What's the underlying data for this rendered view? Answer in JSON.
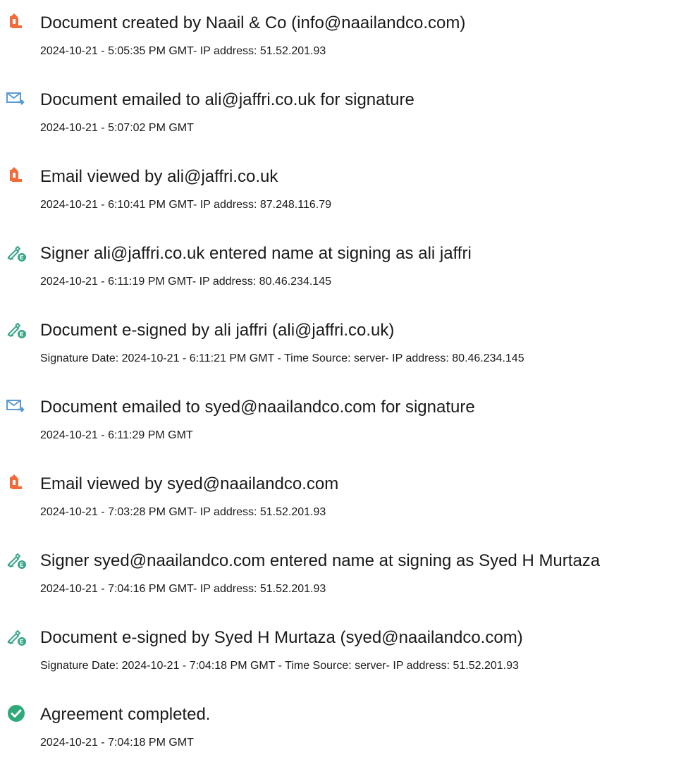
{
  "colors": {
    "document_icon": "#f26b3a",
    "email_icon": "#5b9bd5",
    "signature_icon": "#3aa58a",
    "complete_icon": "#2fa87a",
    "text": "#1a1a1a"
  },
  "events": [
    {
      "icon": "document-created-icon",
      "title": "Document created by Naail & Co (info@naailandco.com)",
      "detail": "2024-10-21 - 5:05:35 PM GMT- IP address: 51.52.201.93"
    },
    {
      "icon": "email-sent-icon",
      "title": "Document emailed to ali@jaffri.co.uk for signature",
      "detail": "2024-10-21 - 5:07:02 PM GMT"
    },
    {
      "icon": "document-viewed-icon",
      "title": "Email viewed by ali@jaffri.co.uk",
      "detail": "2024-10-21 - 6:10:41 PM GMT- IP address: 87.248.116.79"
    },
    {
      "icon": "e-signature-icon",
      "title": "Signer ali@jaffri.co.uk entered name at signing as ali jaffri",
      "detail": "2024-10-21 - 6:11:19 PM GMT- IP address: 80.46.234.145"
    },
    {
      "icon": "e-signature-icon",
      "title": "Document e-signed by ali jaffri (ali@jaffri.co.uk)",
      "detail": "Signature Date: 2024-10-21 - 6:11:21 PM GMT - Time Source: server- IP address: 80.46.234.145"
    },
    {
      "icon": "email-sent-icon",
      "title": "Document emailed to syed@naailandco.com for signature",
      "detail": "2024-10-21 - 6:11:29 PM GMT"
    },
    {
      "icon": "document-viewed-icon",
      "title": "Email viewed by syed@naailandco.com",
      "detail": "2024-10-21 - 7:03:28 PM GMT- IP address: 51.52.201.93"
    },
    {
      "icon": "e-signature-icon",
      "title": "Signer syed@naailandco.com entered name at signing as Syed H Murtaza",
      "detail": "2024-10-21 - 7:04:16 PM GMT- IP address: 51.52.201.93"
    },
    {
      "icon": "e-signature-icon",
      "title": "Document e-signed by Syed H Murtaza (syed@naailandco.com)",
      "detail": "Signature Date: 2024-10-21 - 7:04:18 PM GMT - Time Source: server- IP address: 51.52.201.93"
    },
    {
      "icon": "checkmark-circle-icon",
      "title": "Agreement completed.",
      "detail": "2024-10-21 - 7:04:18 PM GMT"
    }
  ]
}
